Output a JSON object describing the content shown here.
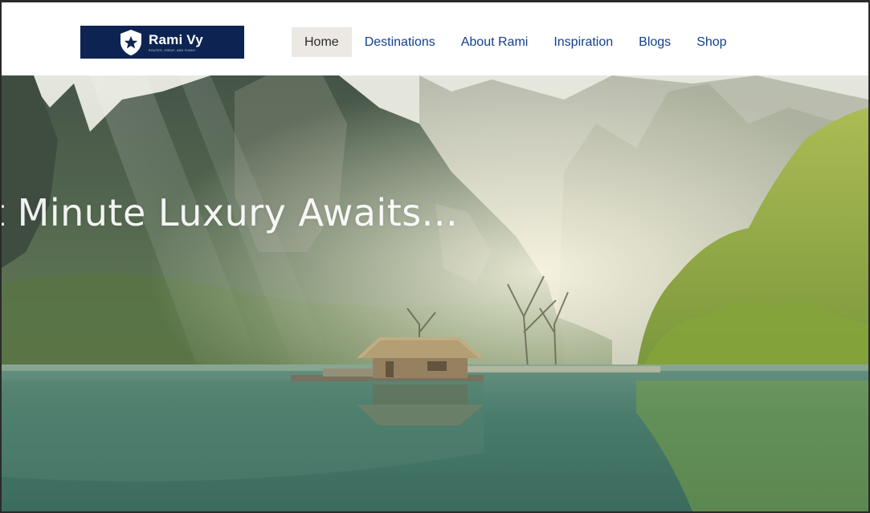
{
  "brand": {
    "name": "Rami Vy",
    "tagline": "ROUTES, GREAT, AND FUNNY",
    "colors": {
      "logo_bg": "#0d2452",
      "nav_link": "#123f8c",
      "active_bg": "#ece9e4"
    },
    "icon": "star-shield-icon"
  },
  "nav": {
    "items": [
      {
        "label": "Home",
        "active": true
      },
      {
        "label": "Destinations",
        "active": false
      },
      {
        "label": "About Rami",
        "active": false
      },
      {
        "label": "Inspiration",
        "active": false
      },
      {
        "label": "Blogs",
        "active": false
      },
      {
        "label": "Shop",
        "active": false
      }
    ]
  },
  "hero": {
    "heading": "t Minute Luxury Awaits...",
    "image": "misty-karst-mountains-lake-hut"
  }
}
